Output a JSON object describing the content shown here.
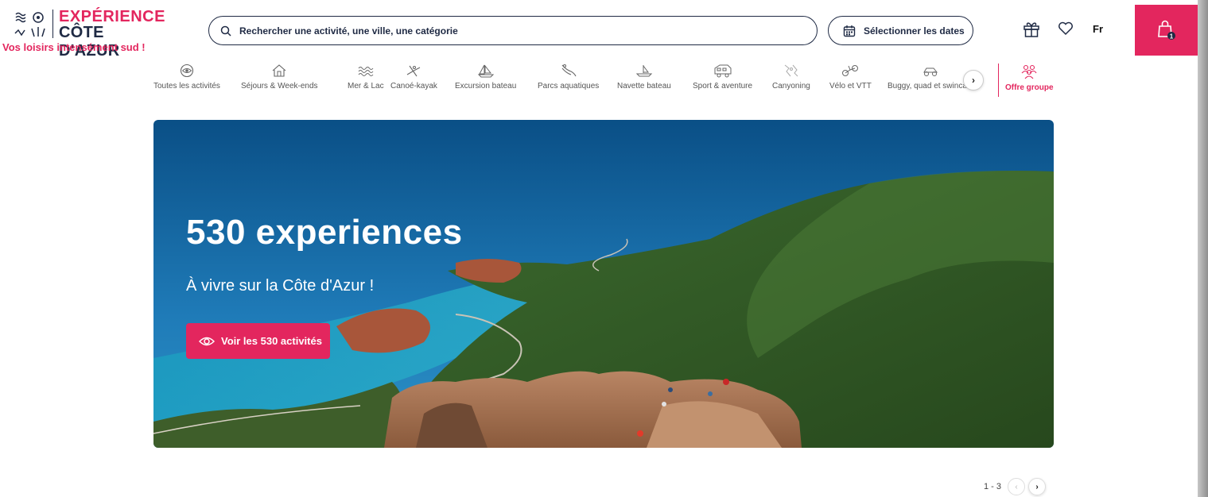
{
  "header": {
    "logo": {
      "line1": "EXPÉRIENCE",
      "line2": "CÔTE D'AZUR",
      "tagline": "Vos loisirs intensément sud !"
    },
    "search_placeholder": "Rechercher une activité, une ville, une catégorie",
    "dates_label": "Sélectionner les dates",
    "language": "Fr",
    "cart_count": "1",
    "brand_color": "#e3265e",
    "dark_color": "#1f2a44"
  },
  "categories": [
    {
      "label": "Toutes les activités",
      "icon": "eye-circle-icon"
    },
    {
      "label": "Séjours & Week-ends",
      "icon": "house-icon"
    },
    {
      "label": "Mer & Lac",
      "icon": "waves-icon"
    },
    {
      "label": "Canoé-kayak",
      "icon": "kayak-icon"
    },
    {
      "label": "Excursion bateau",
      "icon": "sailboat-icon"
    },
    {
      "label": "Parcs aquatiques",
      "icon": "waterslide-icon"
    },
    {
      "label": "Navette bateau",
      "icon": "boat-icon"
    },
    {
      "label": "Sport & aventure",
      "icon": "camper-icon"
    },
    {
      "label": "Canyoning",
      "icon": "canyoning-icon"
    },
    {
      "label": "Vélo et VTT",
      "icon": "bike-icon"
    },
    {
      "label": "Buggy, quad et swinca...",
      "icon": "buggy-icon"
    }
  ],
  "group_offer": {
    "label": "Offre groupe",
    "icon": "group-icon"
  },
  "hero": {
    "title": "530 experiences",
    "subtitle": "À vivre sur la Côte d'Azur !",
    "button_label": "Voir les 530 activités"
  },
  "pagination": {
    "range": "1 - 3",
    "prev": "‹",
    "next": "›"
  }
}
